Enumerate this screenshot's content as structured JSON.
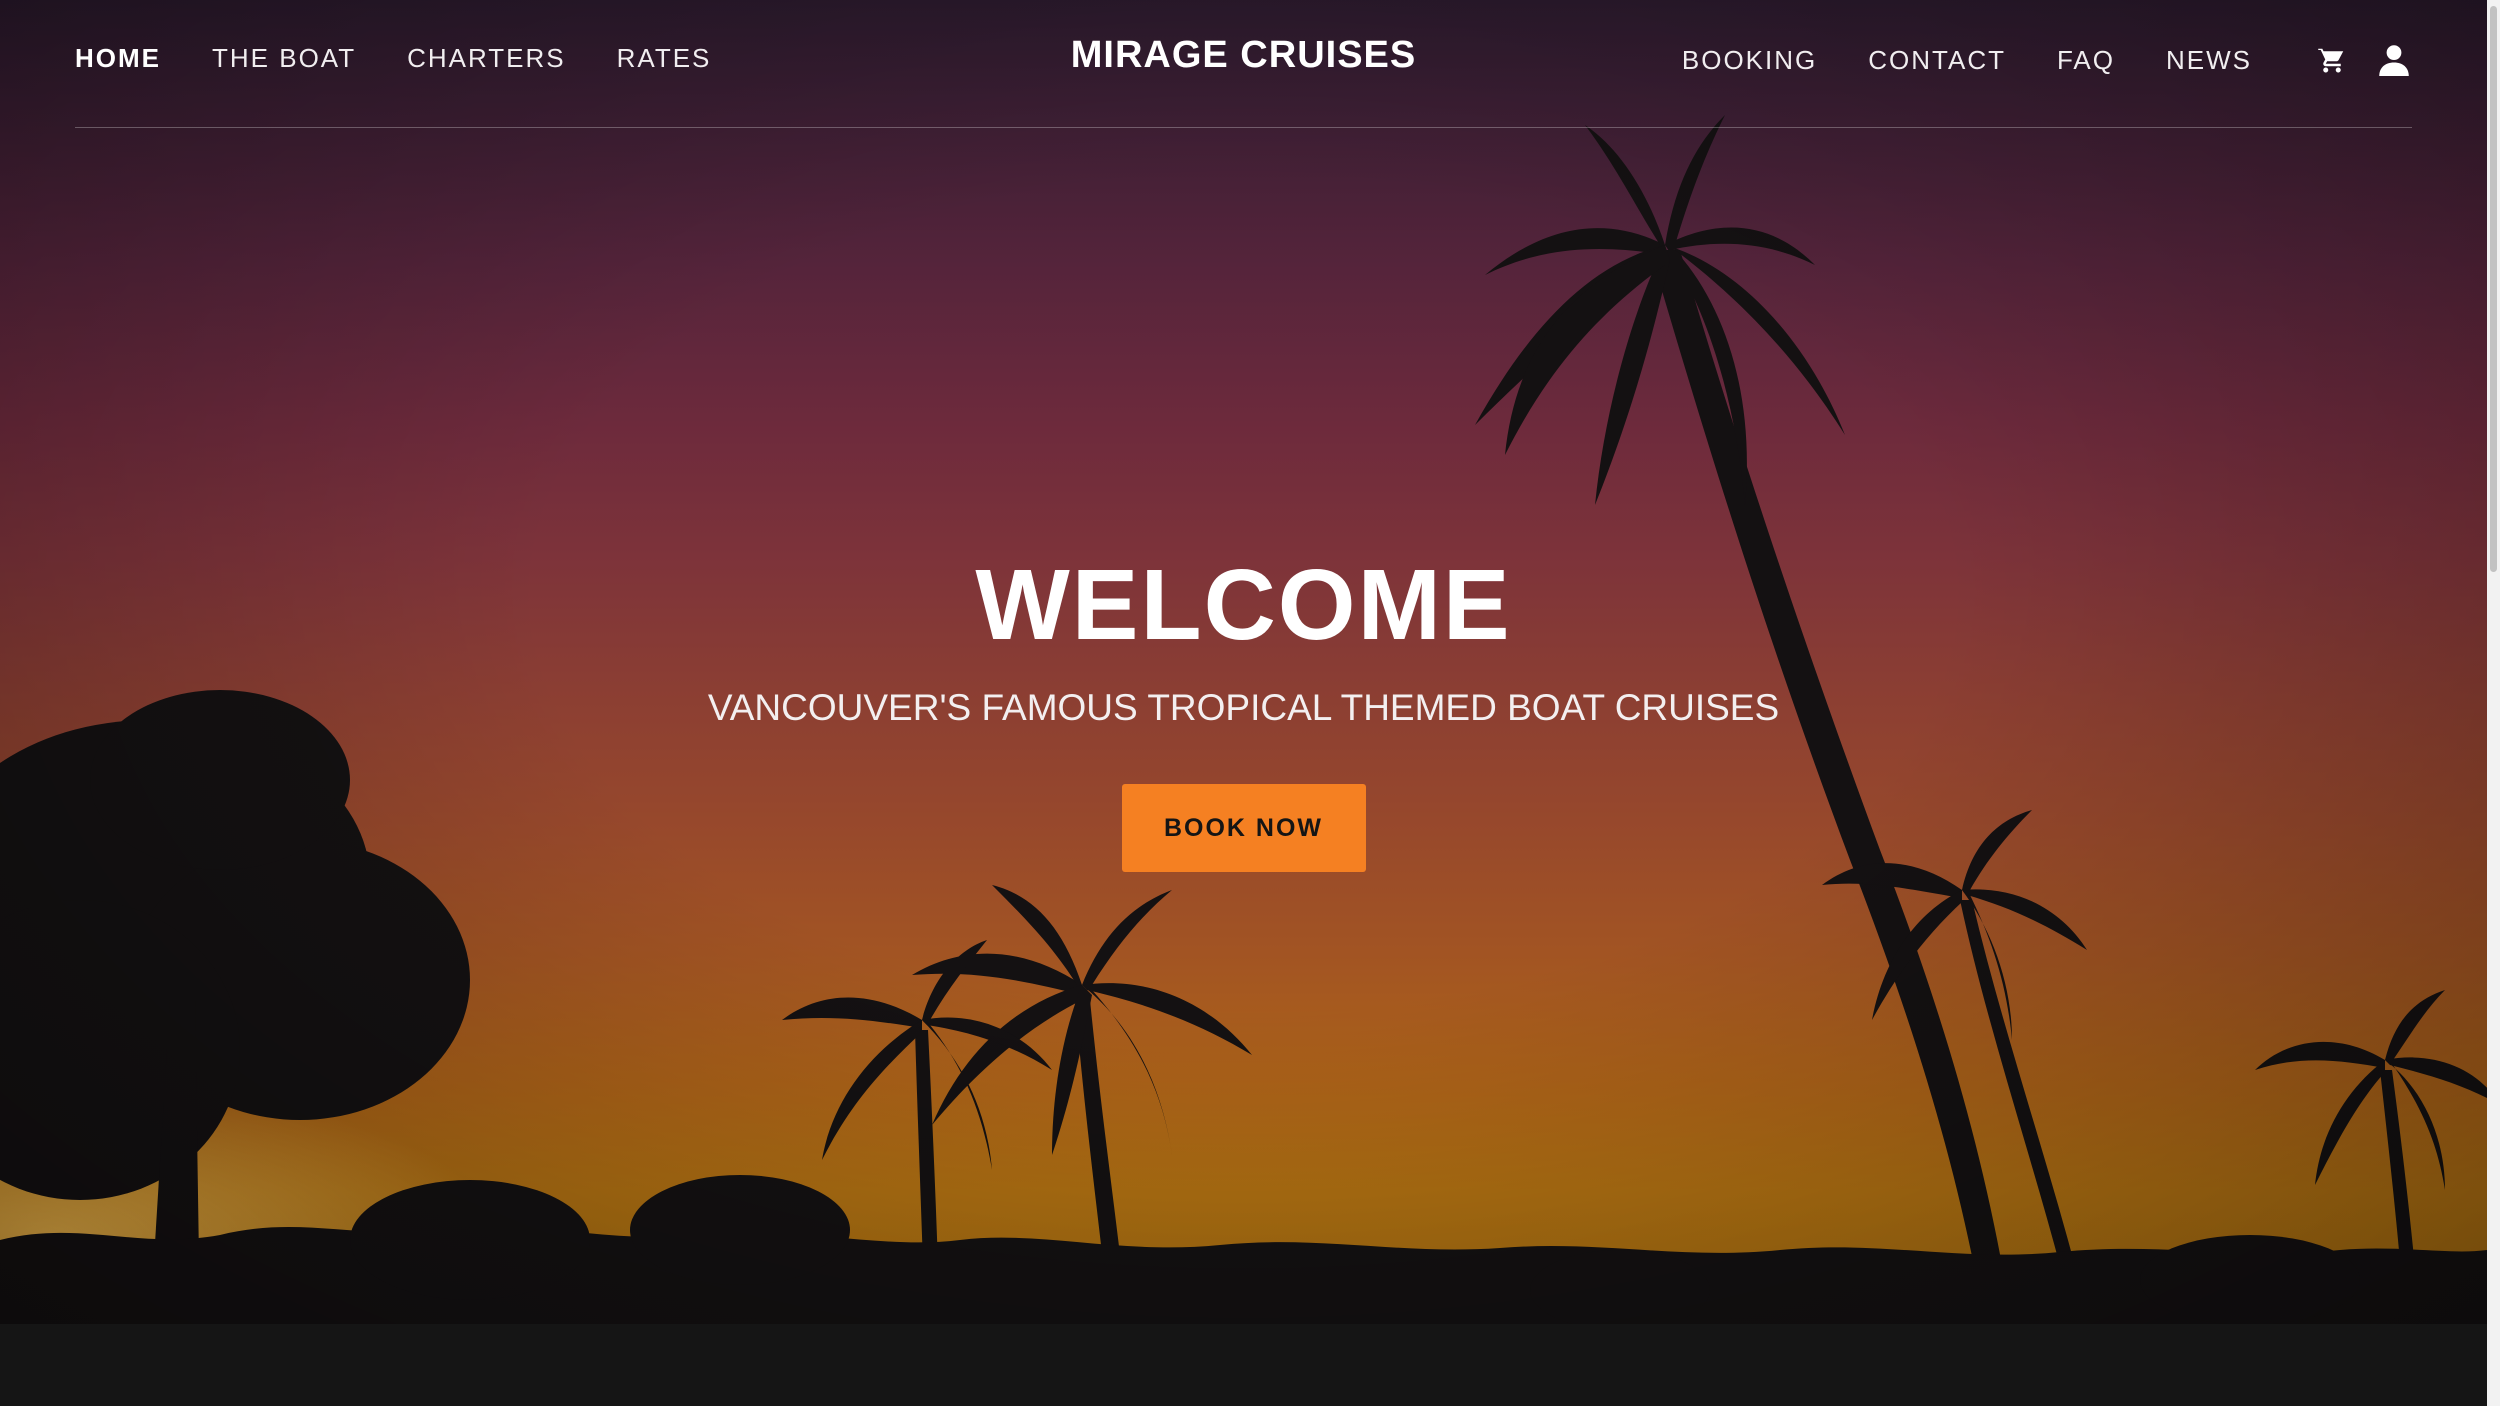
{
  "brand": "MIRAGE CRUISES",
  "nav": {
    "left": [
      {
        "label": "HOME",
        "active": true
      },
      {
        "label": "THE BOAT",
        "active": false
      },
      {
        "label": "CHARTERS",
        "active": false
      },
      {
        "label": "RATES",
        "active": false
      }
    ],
    "right": [
      {
        "label": "BOOKING"
      },
      {
        "label": "CONTACT"
      },
      {
        "label": "FAQ"
      },
      {
        "label": "NEWS"
      }
    ],
    "icons": [
      "cart-icon",
      "account-icon"
    ]
  },
  "hero": {
    "title": "WELCOME",
    "tagline": "VANCOUVER'S FAMOUS TROPICAL THEMED BOAT CRUISES",
    "cta_label": "BOOK NOW",
    "background": "sunset sky with palm tree silhouettes"
  },
  "colors": {
    "accent": "#f58022",
    "text": "#ffffff",
    "footer": "#151515"
  }
}
